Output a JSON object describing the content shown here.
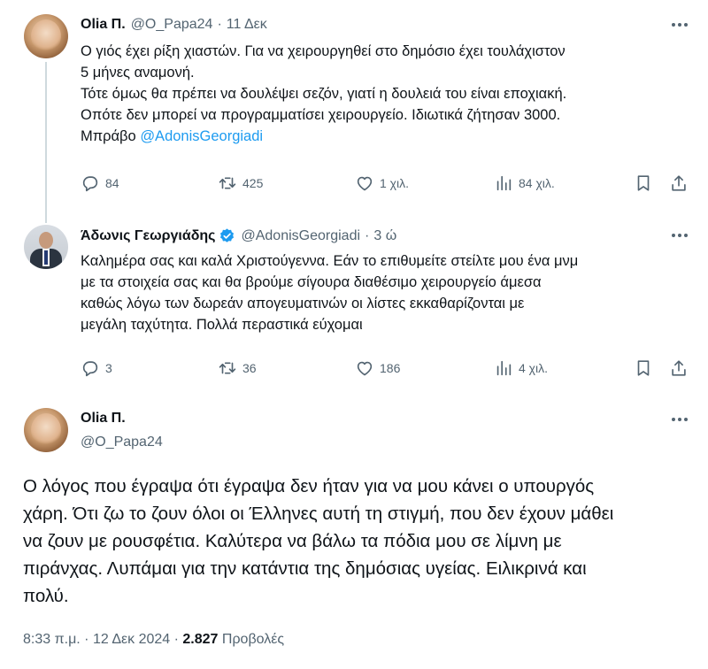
{
  "tweets": [
    {
      "name": "Olia Π.",
      "handle": "@O_Papa24",
      "time": "11 Δεκ",
      "lines": [
        "Ο γιός έχει ρίξη χιαστών. Για να χειρουργηθεί στο δημόσιο έχει τουλάχιστον",
        "5 μήνες αναμονή.",
        "Τότε όμως θα πρέπει να δουλέψει σεζόν, γιατί η δουλειά του είναι εποχιακή.",
        "Οπότε δεν μπορεί να προγραμματίσει χειρουργείο. Ιδιωτικά ζήτησαν 3000."
      ],
      "last_line_prefix": "Μπράβο ",
      "mention": "@AdonisGeorgiadi",
      "replies": "84",
      "retweets": "425",
      "likes": "1 χιλ.",
      "views": "84 χιλ."
    },
    {
      "name": "Άδωνις Γεωργιάδης",
      "handle": "@AdonisGeorgiadi",
      "time": "3 ώ",
      "lines": [
        "Καλημέρα σας και καλά Χριστούγεννα. Εάν το επιθυμείτε στείλτε μου ένα μνμ",
        "με τα στοιχεία σας και θα βρούμε σίγουρα διαθέσιμο χειρουργείο άμεσα",
        "καθώς λόγω των δωρεάν απογευματινών οι λίστες εκκαθαρίζονται με",
        "μεγάλη ταχύτητα. Πολλά περαστικά εύχομαι"
      ],
      "replies": "3",
      "retweets": "36",
      "likes": "186",
      "views": "4 χιλ."
    }
  ],
  "main_tweet": {
    "name": "Olia Π.",
    "handle": "@O_Papa24",
    "lines": [
      "Ο λόγος που έγραψα ότι έγραψα δεν ήταν για να μου κάνει ο υπουργός",
      "χάρη. Ότι ζω το ζουν όλοι οι Έλληνες αυτή τη στιγμή, που δεν έχουν μάθει",
      "να ζουν με ρουσφέτια. Καλύτερα να βάλω τα πόδια μου σε λίμνη με",
      "πιράνχας. Λυπάμαι για την κατάντια της δημόσιας υγείας. Ειλικρινά και",
      "πολύ."
    ],
    "timestamp": "8:33 π.μ. · 12 Δεκ 2024 · ",
    "views_count": "2.827",
    "views_label": " Προβολές"
  },
  "colors": {
    "accent": "#1d9bf0",
    "secondary_text": "#536471",
    "primary_text": "#0f1419",
    "thread_line": "#cfd9de"
  },
  "icons": [
    "more-icon",
    "reply-icon",
    "retweet-icon",
    "like-icon",
    "views-icon",
    "bookmark-icon",
    "share-icon",
    "verified-badge-icon"
  ]
}
